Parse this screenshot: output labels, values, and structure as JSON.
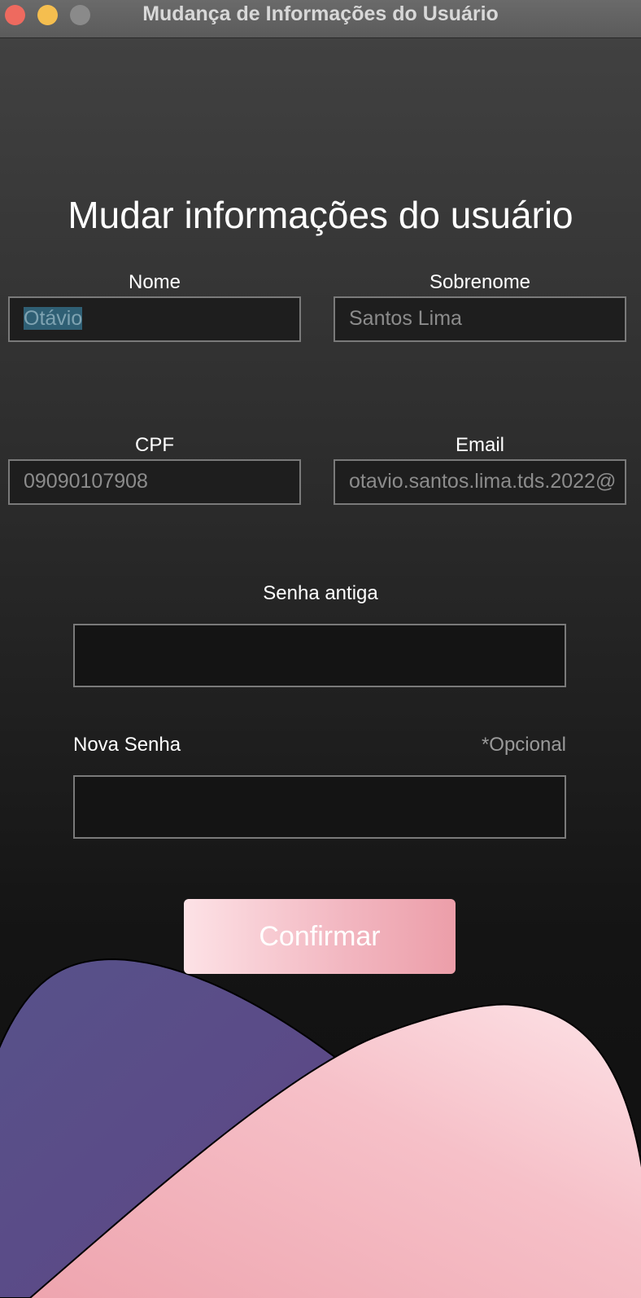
{
  "window": {
    "title": "Mudança de Informações do Usuário"
  },
  "form": {
    "heading": "Mudar informações do usuário",
    "nome": {
      "label": "Nome",
      "value": "Otávio"
    },
    "sobrenome": {
      "label": "Sobrenome",
      "value": "Santos Lima"
    },
    "cpf": {
      "label": "CPF",
      "value": "09090107908"
    },
    "email": {
      "label": "Email",
      "value": "otavio.santos.lima.tds.2022@"
    },
    "senha_antiga": {
      "label": "Senha antiga",
      "value": ""
    },
    "nova_senha": {
      "label": "Nova Senha",
      "value": "",
      "hint": "*Opcional"
    },
    "confirm_label": "Confirmar"
  },
  "colors": {
    "background_top": "#434343",
    "background_bottom": "#0f0f0f",
    "button_gradient_start": "#fde2e6",
    "button_gradient_end": "#ec9ea9",
    "purple_blob": "#5a4d8a",
    "pink_blob": "#f2b6c0"
  },
  "icons": [
    "close-window-icon",
    "minimize-window-icon",
    "maximize-window-icon"
  ]
}
